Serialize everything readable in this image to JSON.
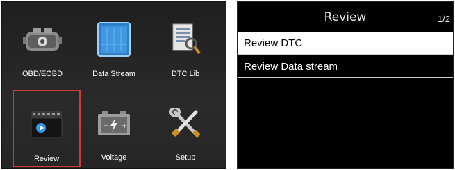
{
  "left_menu": {
    "items": [
      {
        "label": "OBD/EOBD",
        "icon": "car-engine-icon"
      },
      {
        "label": "Data Stream",
        "icon": "data-stream-icon"
      },
      {
        "label": "DTC Lib",
        "icon": "dtc-library-icon"
      },
      {
        "label": "Review",
        "icon": "review-film-icon",
        "selected": true
      },
      {
        "label": "Voltage",
        "icon": "battery-icon"
      },
      {
        "label": "Setup",
        "icon": "tools-icon"
      }
    ]
  },
  "review_screen": {
    "title": "Review",
    "page_indicator": "1/2",
    "items": [
      {
        "label": "Review DTC",
        "selected": true
      },
      {
        "label": "Review Data stream",
        "selected": false
      }
    ]
  },
  "colors": {
    "selection_border": "#d03a3a",
    "screen_bg": "#000000"
  }
}
